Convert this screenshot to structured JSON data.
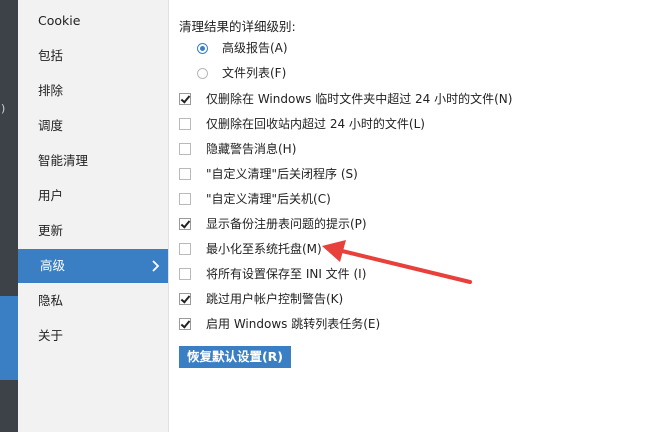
{
  "nav": {
    "items": [
      {
        "label": "Cookie",
        "active": false
      },
      {
        "label": "包括",
        "active": false
      },
      {
        "label": "排除",
        "active": false
      },
      {
        "label": "调度",
        "active": false
      },
      {
        "label": "智能清理",
        "active": false
      },
      {
        "label": "用户",
        "active": false
      },
      {
        "label": "更新",
        "active": false
      },
      {
        "label": "高级",
        "active": true
      },
      {
        "label": "隐私",
        "active": false
      },
      {
        "label": "关于",
        "active": false
      }
    ]
  },
  "report": {
    "title": "清理结果的详细级别:",
    "options": [
      {
        "label": "高级报告(A)",
        "selected": true
      },
      {
        "label": "文件列表(F)",
        "selected": false
      }
    ]
  },
  "options": [
    {
      "label": "仅删除在 Windows 临时文件夹中超过 24 小时的文件(N)",
      "checked": true
    },
    {
      "label": "仅删除在回收站内超过 24 小时的文件(L)",
      "checked": false
    },
    {
      "label": "隐藏警告消息(H)",
      "checked": false
    },
    {
      "label": "\"自定义清理\"后关闭程序 (S)",
      "checked": false
    },
    {
      "label": "\"自定义清理\"后关机(C)",
      "checked": false
    },
    {
      "label": "显示备份注册表问题的提示(P)",
      "checked": true
    },
    {
      "label": "最小化至系统托盘(M)",
      "checked": false
    },
    {
      "label": "将所有设置保存至 INI 文件 (I)",
      "checked": false
    },
    {
      "label": "跳过用户帐户控制警告(K)",
      "checked": true
    },
    {
      "label": "启用 Windows 跳转列表任务(E)",
      "checked": true
    }
  ],
  "restore_button": {
    "label": "恢复默认设置(R)"
  },
  "colors": {
    "accent": "#3a7fc4",
    "annotation_arrow": "#e8403a",
    "nav_bg": "#f2f2f2",
    "strip_bg": "#3d4248"
  },
  "icons": {
    "nav_active": "chevron-right-icon",
    "annotation": "red-arrow-icon"
  }
}
